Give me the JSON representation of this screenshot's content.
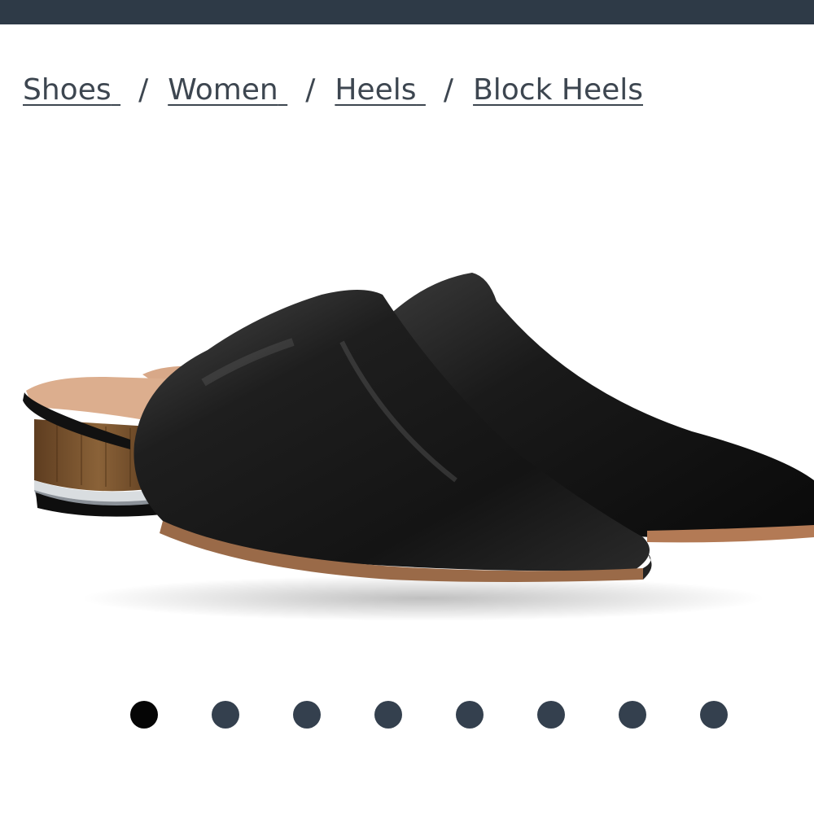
{
  "breadcrumb": {
    "items": [
      {
        "label": "Shoes"
      },
      {
        "label": "Women"
      },
      {
        "label": "Heels"
      },
      {
        "label": "Block Heels"
      }
    ],
    "separator": "/"
  },
  "product_image": {
    "description": "black-pointed-toe-mule-pair",
    "colors": {
      "leather": "#161616",
      "heel_wood": "#7a5530",
      "lining": "#d8a888"
    }
  },
  "carousel": {
    "total": 8,
    "active_index": 0,
    "colors": {
      "active": "#050505",
      "inactive": "#34404e"
    }
  },
  "header": {
    "bar_color": "#2e3a47"
  }
}
